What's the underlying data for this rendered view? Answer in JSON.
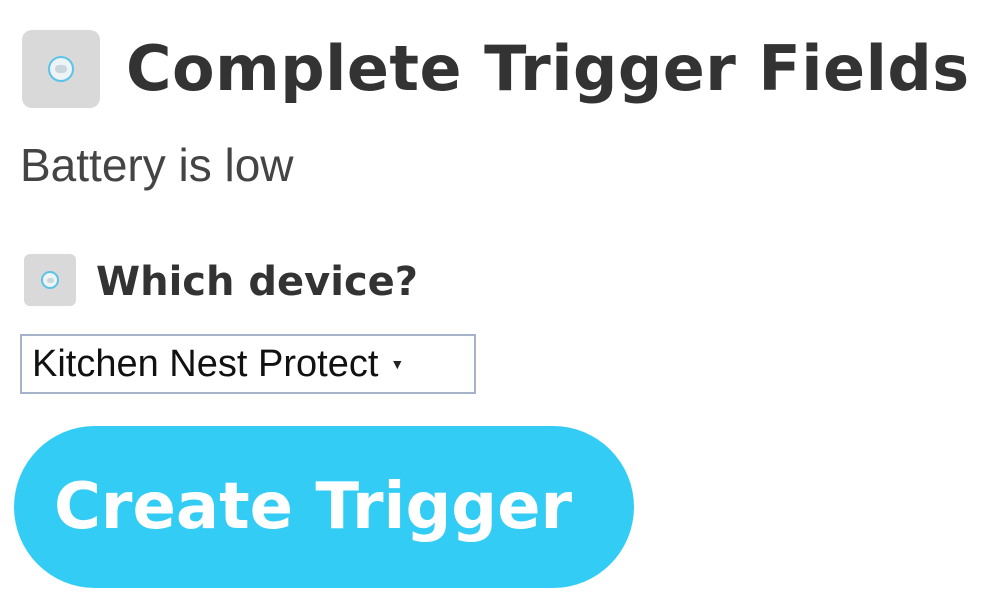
{
  "header": {
    "title": "Complete Trigger Fields",
    "icon": "nest-protect-icon"
  },
  "trigger": {
    "description": "Battery is low"
  },
  "field": {
    "label": "Which device?",
    "icon": "nest-protect-icon",
    "selected_value": "Kitchen Nest Protect"
  },
  "actions": {
    "create_label": "Create Trigger"
  },
  "colors": {
    "button": "#33ccf5",
    "button_text": "#ffffff",
    "icon_bg": "#d9d9d9",
    "icon_ring": "#5cc3e8",
    "select_border": "#a6b3c9",
    "text": "#333333"
  }
}
